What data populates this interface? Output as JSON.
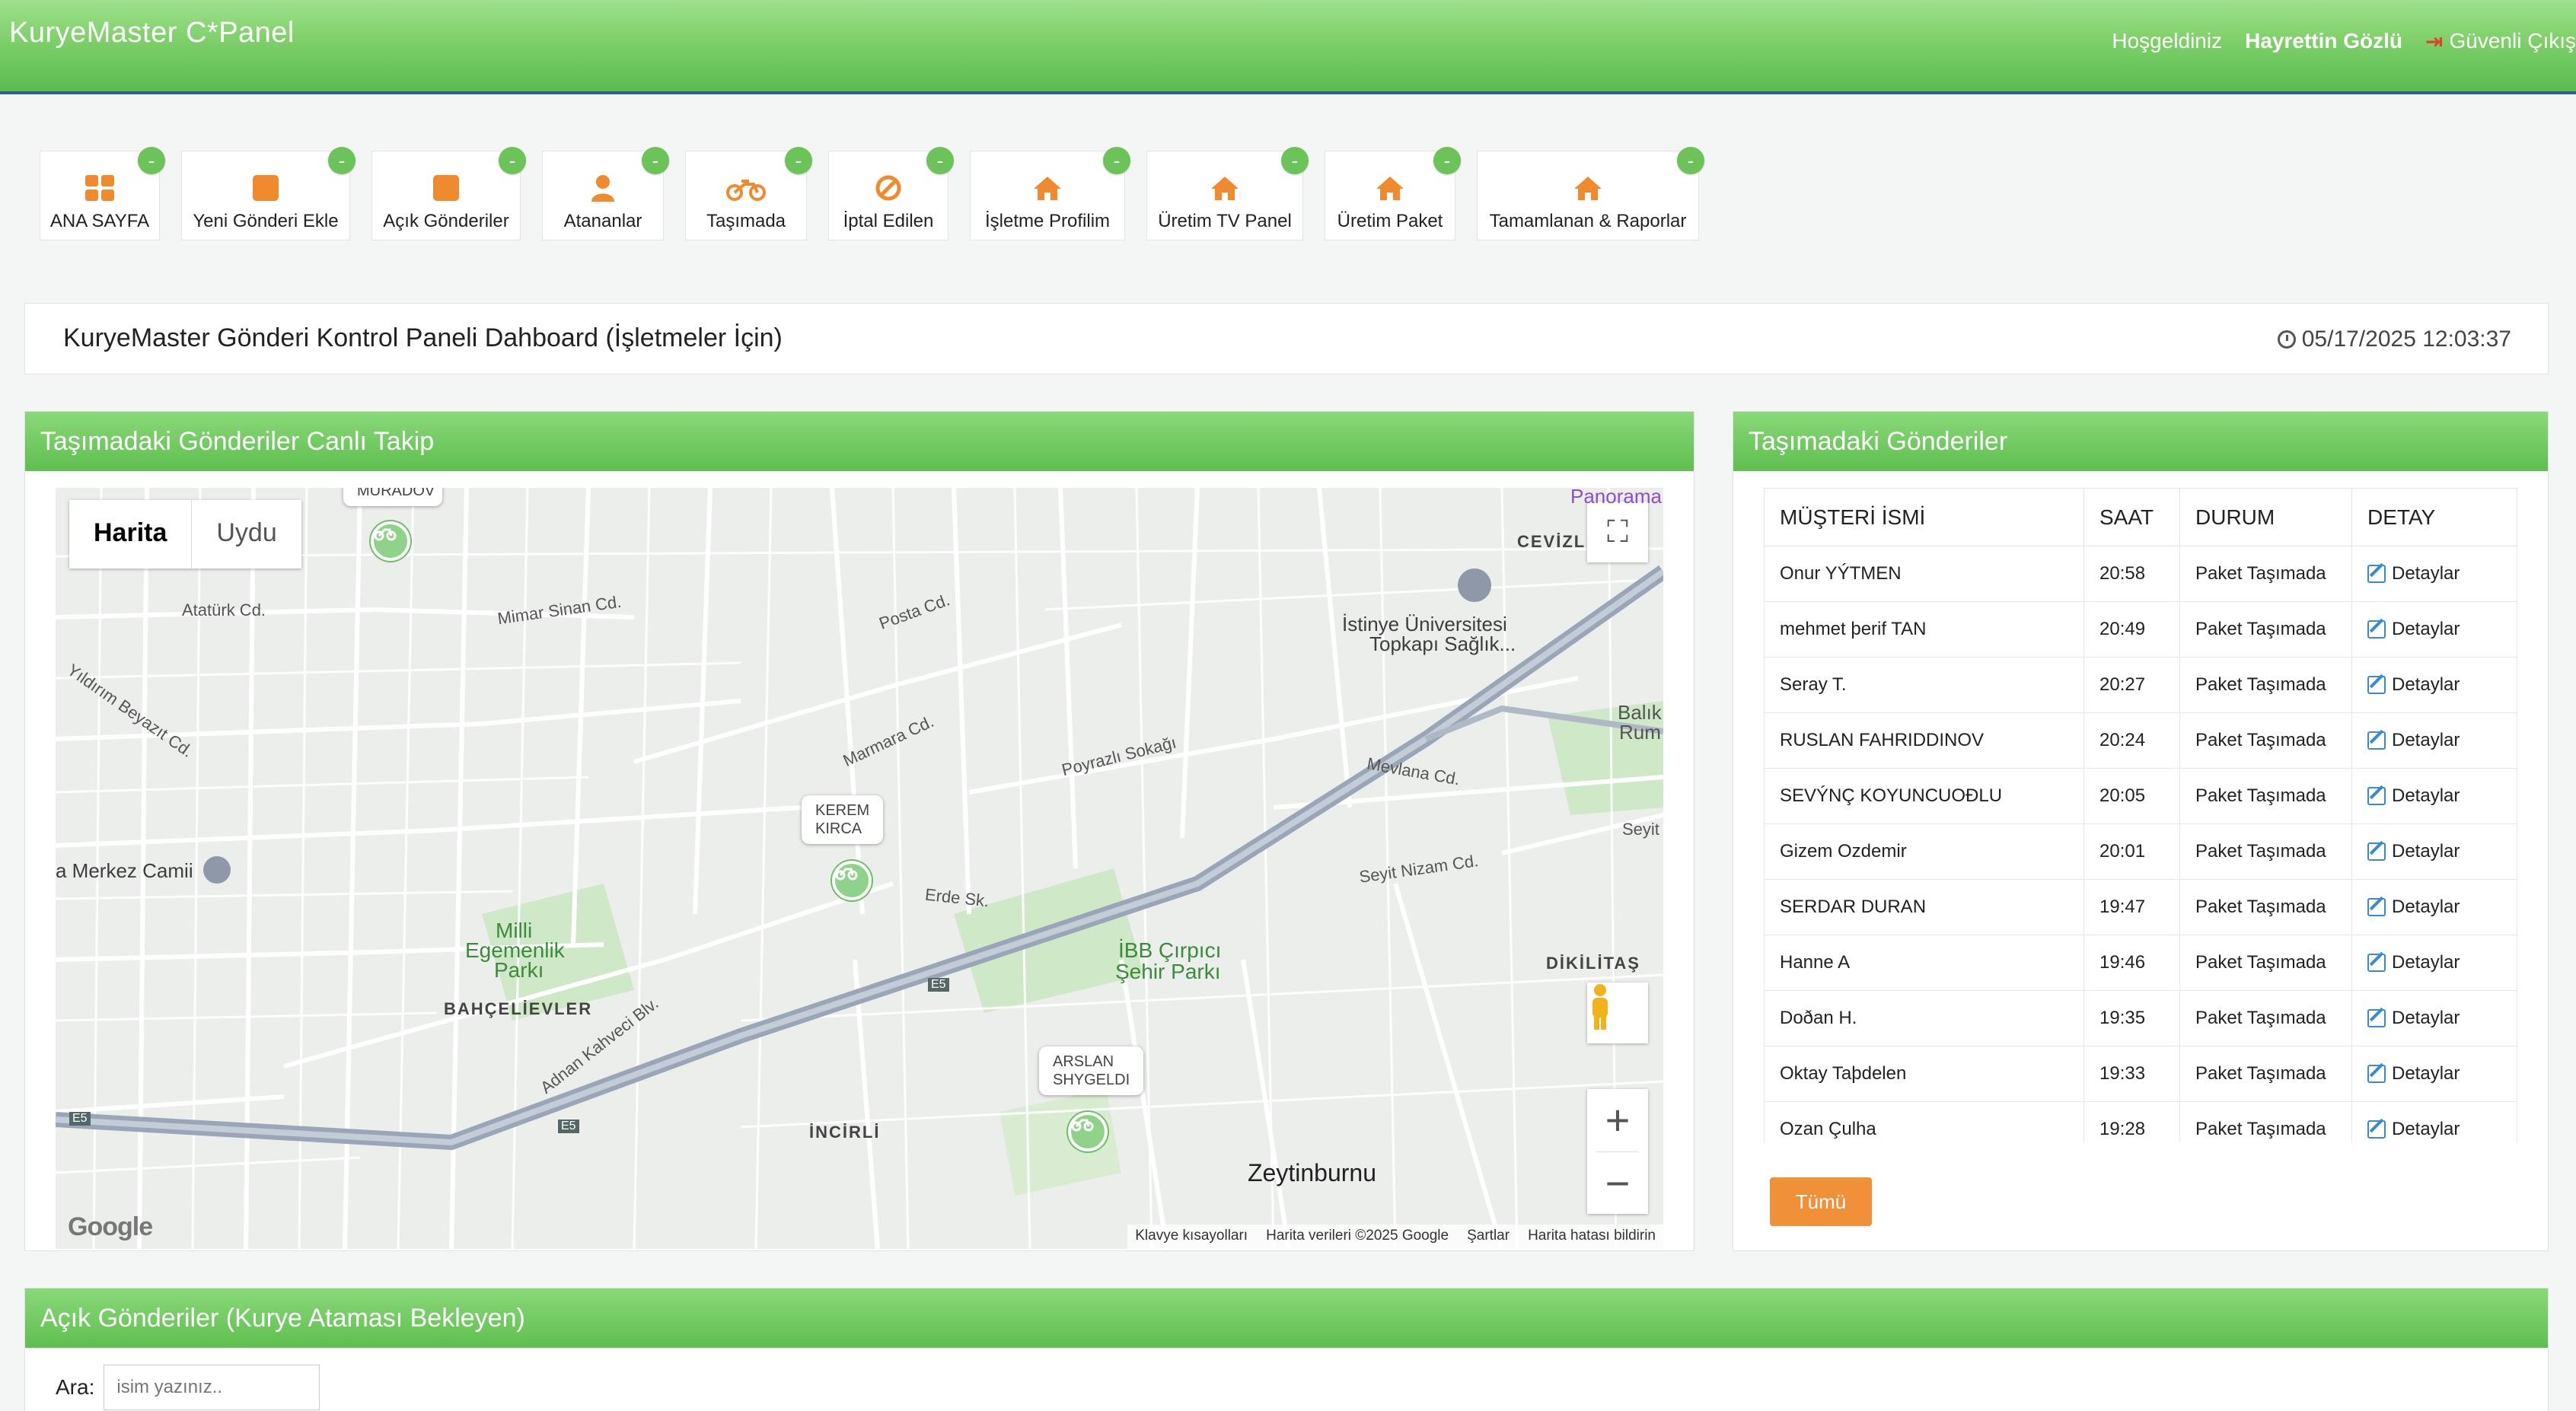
{
  "header": {
    "brand": "KuryeMaster C*Panel",
    "welcome": "Hoşgeldiniz",
    "user": "Hayrettin Gözlü",
    "logout": "Güvenli Çıkış"
  },
  "nav": [
    {
      "label": "ANA SAYFA",
      "icon": "dashboard-grid-icon",
      "badge": "-"
    },
    {
      "label": "Yeni Gönderi Ekle",
      "icon": "square-icon",
      "badge": "-"
    },
    {
      "label": "Açık Gönderiler",
      "icon": "square-icon",
      "badge": "-"
    },
    {
      "label": "Atananlar",
      "icon": "user-icon",
      "badge": "-"
    },
    {
      "label": "Taşımada",
      "icon": "motorcycle-icon",
      "badge": "-"
    },
    {
      "label": "İptal Edilen",
      "icon": "ban-icon",
      "badge": "-"
    },
    {
      "label": "İşletme Profilim",
      "icon": "home-icon",
      "badge": "-"
    },
    {
      "label": "Üretim TV Panel",
      "icon": "home-icon",
      "badge": "-"
    },
    {
      "label": "Üretim Paket",
      "icon": "home-icon",
      "badge": "-"
    },
    {
      "label": "Tamamlanan & Raporlar",
      "icon": "home-icon",
      "badge": "-"
    }
  ],
  "page": {
    "title": "KuryeMaster Gönderi Kontrol Paneli Dahboard (İşletmeler İçin)",
    "datetime": "05/17/2025 12:03:37"
  },
  "map_panel": {
    "title": "Taşımadaki Gönderiler Canlı Takip",
    "map_type_map": "Harita",
    "map_type_satellite": "Uydu",
    "google": "Google",
    "attribution": [
      "Klavye kısayolları",
      "Harita verileri ©2025 Google",
      "Şartlar",
      "Harita hatası bildirin"
    ],
    "couriers": [
      {
        "name_line1": "KEREM",
        "name_line2": "KIRCA"
      },
      {
        "name_line1": "ARSLAN",
        "name_line2": "SHYGELDI"
      },
      {
        "name_line1": "MURADOV",
        "name_line2": ""
      }
    ],
    "labels": {
      "atamurk": "Atatürk Cd.",
      "mimarsinan": "Mimar Sinan Cd.",
      "merkez": "a Merkez Camii",
      "milli": "Milli",
      "egemenlik": "Egemenlik",
      "parki": "Parkı",
      "bahcelievler": "BAHÇELİEVLER",
      "incirli": "İNCİRLİ",
      "zeytinburnu": "Zeytinburnu",
      "ibb": "İBB Çırpıcı",
      "sehirparki": "Şehir Parkı",
      "istinye": "İstinye Üniversitesi",
      "topkapi": "Topkapı Sağlık...",
      "cevizli": "CEVİZL",
      "dikilitas": "DİKİLİTAŞ",
      "mevlana": "Mevlana Cd.",
      "seyitnizam": "Seyit Nizam Cd.",
      "erde": "Erde Sk.",
      "panorama": "Panorama",
      "poyrazli": "Poyrazlı Sokağı",
      "marmara": "Marmara Cd.",
      "posta": "Posta Cd.",
      "yavuz": "Yıldırım Beyazıt Cd.",
      "adnan": "Adnan Kahveci Blv.",
      "e5a": "E5",
      "e5b": "E5",
      "e5c": "E5",
      "balikli": "Balık",
      "rum": "Rum",
      "seyit": "Seyit"
    }
  },
  "shipments": {
    "title": "Taşımadaki Gönderiler",
    "columns": [
      "MÜŞTERİ İSMİ",
      "SAAT",
      "DURUM",
      "DETAY"
    ],
    "rows": [
      {
        "name": "Onur YÝTMEN",
        "time": "20:58",
        "status": "Paket Taşımada",
        "detail": "Detaylar"
      },
      {
        "name": "mehmet þerif TAN",
        "time": "20:49",
        "status": "Paket Taşımada",
        "detail": "Detaylar"
      },
      {
        "name": "Seray T.",
        "time": "20:27",
        "status": "Paket Taşımada",
        "detail": "Detaylar"
      },
      {
        "name": "RUSLAN FAHRIDDINOV",
        "time": "20:24",
        "status": "Paket Taşımada",
        "detail": "Detaylar"
      },
      {
        "name": "SEVÝNÇ KOYUNCUOÐLU",
        "time": "20:05",
        "status": "Paket Taşımada",
        "detail": "Detaylar"
      },
      {
        "name": "Gizem Ozdemir",
        "time": "20:01",
        "status": "Paket Taşımada",
        "detail": "Detaylar"
      },
      {
        "name": "SERDAR DURAN",
        "time": "19:47",
        "status": "Paket Taşımada",
        "detail": "Detaylar"
      },
      {
        "name": "Hanne A",
        "time": "19:46",
        "status": "Paket Taşımada",
        "detail": "Detaylar"
      },
      {
        "name": "Doðan H.",
        "time": "19:35",
        "status": "Paket Taşımada",
        "detail": "Detaylar"
      },
      {
        "name": "Oktay Taþdelen",
        "time": "19:33",
        "status": "Paket Taşımada",
        "detail": "Detaylar"
      },
      {
        "name": "Ozan Çulha",
        "time": "19:28",
        "status": "Paket Taşımada",
        "detail": "Detaylar"
      }
    ],
    "all_button": "Tümü"
  },
  "open_panel": {
    "title": "Açık Gönderiler (Kurye Ataması Bekleyen)",
    "search_label": "Ara:",
    "search_placeholder": "isim yazınız.."
  },
  "colors": {
    "header_green": "#7ed06a",
    "accent_orange": "#f08a2e",
    "badge_green": "#6cc35a"
  }
}
